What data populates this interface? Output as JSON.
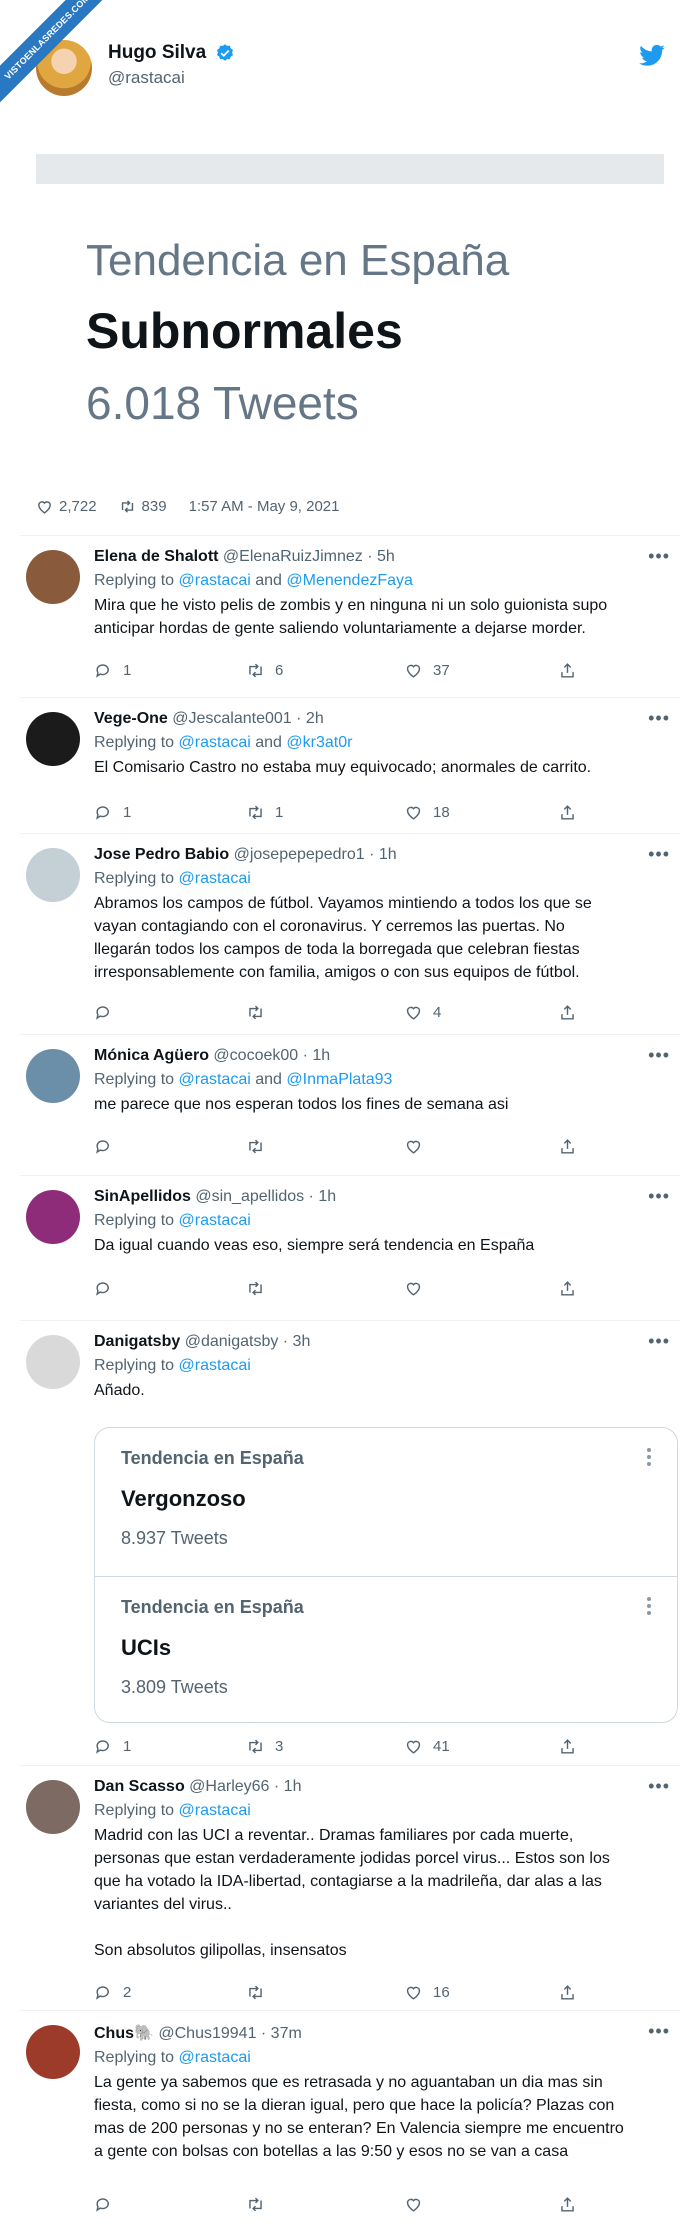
{
  "watermark": "VISTOENLASREDES.COM",
  "tweet": {
    "display_name": "Hugo Silva",
    "handle": "@rastacai",
    "trend_label": "Tendencia en España",
    "trend_topic": "Subnormales",
    "trend_count": "6.018 Tweets",
    "likes": "2,722",
    "retweets": "839",
    "timestamp": "1:57 AM - May 9, 2021"
  },
  "replying_prefix": "Replying to",
  "and_word": "and",
  "replies": [
    {
      "name": "Elena de Shalott",
      "meta": "@ElenaRuizJimnez · 5h",
      "replying_to": [
        "@rastacai",
        "@MenendezFaya"
      ],
      "text": "Mira que he visto pelis de zombis y en ninguna ni un solo guionista supo\nanticipar hordas de gente saliendo voluntariamente a dejarse morder.",
      "replies_count": "1",
      "retweets_count": "6",
      "likes_count": "37",
      "avatar_color": "#8a5a3c"
    },
    {
      "name": "Vege-One",
      "meta": "@Jescalante001 · 2h",
      "replying_to": [
        "@rastacai",
        "@kr3at0r"
      ],
      "text": "El Comisario Castro no estaba muy equivocado; anormales de carrito.",
      "replies_count": "1",
      "retweets_count": "1",
      "likes_count": "18",
      "avatar_color": "#1b1b1b"
    },
    {
      "name": "Jose Pedro Babio",
      "meta": "@josepepepedro1 · 1h",
      "replying_to": [
        "@rastacai"
      ],
      "text": "Abramos los campos de fútbol. Vayamos mintiendo a todos los que se\nvayan contagiando con el coronavirus. Y cerremos las puertas. No\nllegarán todos los campos de toda la borregada que celebran fiestas\nirresponsablemente con familia, amigos o con sus equipos de fútbol.",
      "replies_count": "",
      "retweets_count": "",
      "likes_count": "4",
      "avatar_color": "#c4cfd6"
    },
    {
      "name": "Mónica Agüero",
      "meta": "@cocoek00 · 1h",
      "replying_to": [
        "@rastacai",
        "@InmaPlata93"
      ],
      "text": "me parece que nos esperan todos los fines de semana asi",
      "replies_count": "",
      "retweets_count": "",
      "likes_count": "",
      "avatar_color": "#6b8fa8"
    },
    {
      "name": "SinApellidos",
      "meta": "@sin_apellidos · 1h",
      "replying_to": [
        "@rastacai"
      ],
      "text": "Da igual cuando veas eso, siempre será tendencia en España",
      "replies_count": "",
      "retweets_count": "",
      "likes_count": "",
      "avatar_color": "#8e2c7a"
    },
    {
      "name": "Danigatsby",
      "meta": "@danigatsby · 3h",
      "replying_to": [
        "@rastacai"
      ],
      "text": "Añado.",
      "replies_count": "1",
      "retweets_count": "3",
      "likes_count": "41",
      "avatar_color": "#d9d9d9"
    },
    {
      "name": "Dan Scasso",
      "meta": "@Harley66 · 1h",
      "replying_to": [
        "@rastacai"
      ],
      "text": "Madrid con las UCI a reventar.. Dramas familiares por cada muerte,\npersonas que estan verdaderamente jodidas porcel virus... Estos son los\nque ha votado la IDA-libertad, contagiarse a la madrileña, dar alas a las\nvariantes del virus..\n\nSon absolutos gilipollas, insensatos",
      "replies_count": "2",
      "retweets_count": "",
      "likes_count": "16",
      "avatar_color": "#7d6a62"
    },
    {
      "name": "Chus🐘",
      "meta": "@Chus19941 · 37m",
      "replying_to": [
        "@rastacai"
      ],
      "text": "La gente ya sabemos que es retrasada y no aguantaban un dia mas sin\nfiesta, como si no se la dieran igual, pero que hace la policía? Plazas con\nmas de 200 personas y no se enteran? En Valencia siempre me encuentro\na gente con bolsas con botellas a las 9:50 y esos no se van a casa",
      "replies_count": "",
      "retweets_count": "",
      "likes_count": "",
      "avatar_color": "#9c3b2a"
    }
  ],
  "embedded_trends": [
    {
      "label": "Tendencia en España",
      "topic": "Vergonzoso",
      "count": "8.937 Tweets"
    },
    {
      "label": "Tendencia en España",
      "topic": "UCIs",
      "count": "3.809 Tweets"
    }
  ],
  "colors": {
    "accent": "#1d9bf0",
    "muted": "#536471",
    "ribbon": "#2b78c2"
  }
}
